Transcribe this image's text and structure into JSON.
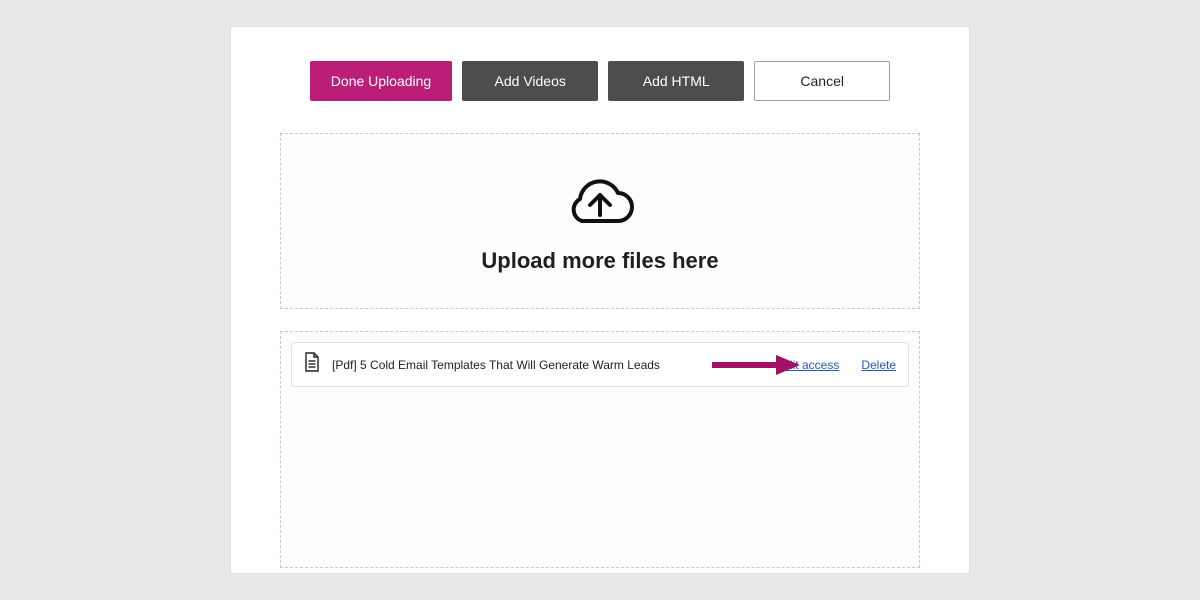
{
  "colors": {
    "accent": "#ba1e79",
    "dark": "#4d4d4d",
    "link": "#2559c2",
    "annotation": "#a01065"
  },
  "toolbar": {
    "done_label": "Done Uploading",
    "add_videos_label": "Add Videos",
    "add_html_label": "Add HTML",
    "cancel_label": "Cancel"
  },
  "dropzone": {
    "label": "Upload more files here",
    "icon": "cloud-upload-icon"
  },
  "files": [
    {
      "icon": "document-icon",
      "name": "[Pdf] 5 Cold Email Templates That Will Generate Warm Leads",
      "edit_access_label": "Edit access",
      "delete_label": "Delete"
    }
  ]
}
